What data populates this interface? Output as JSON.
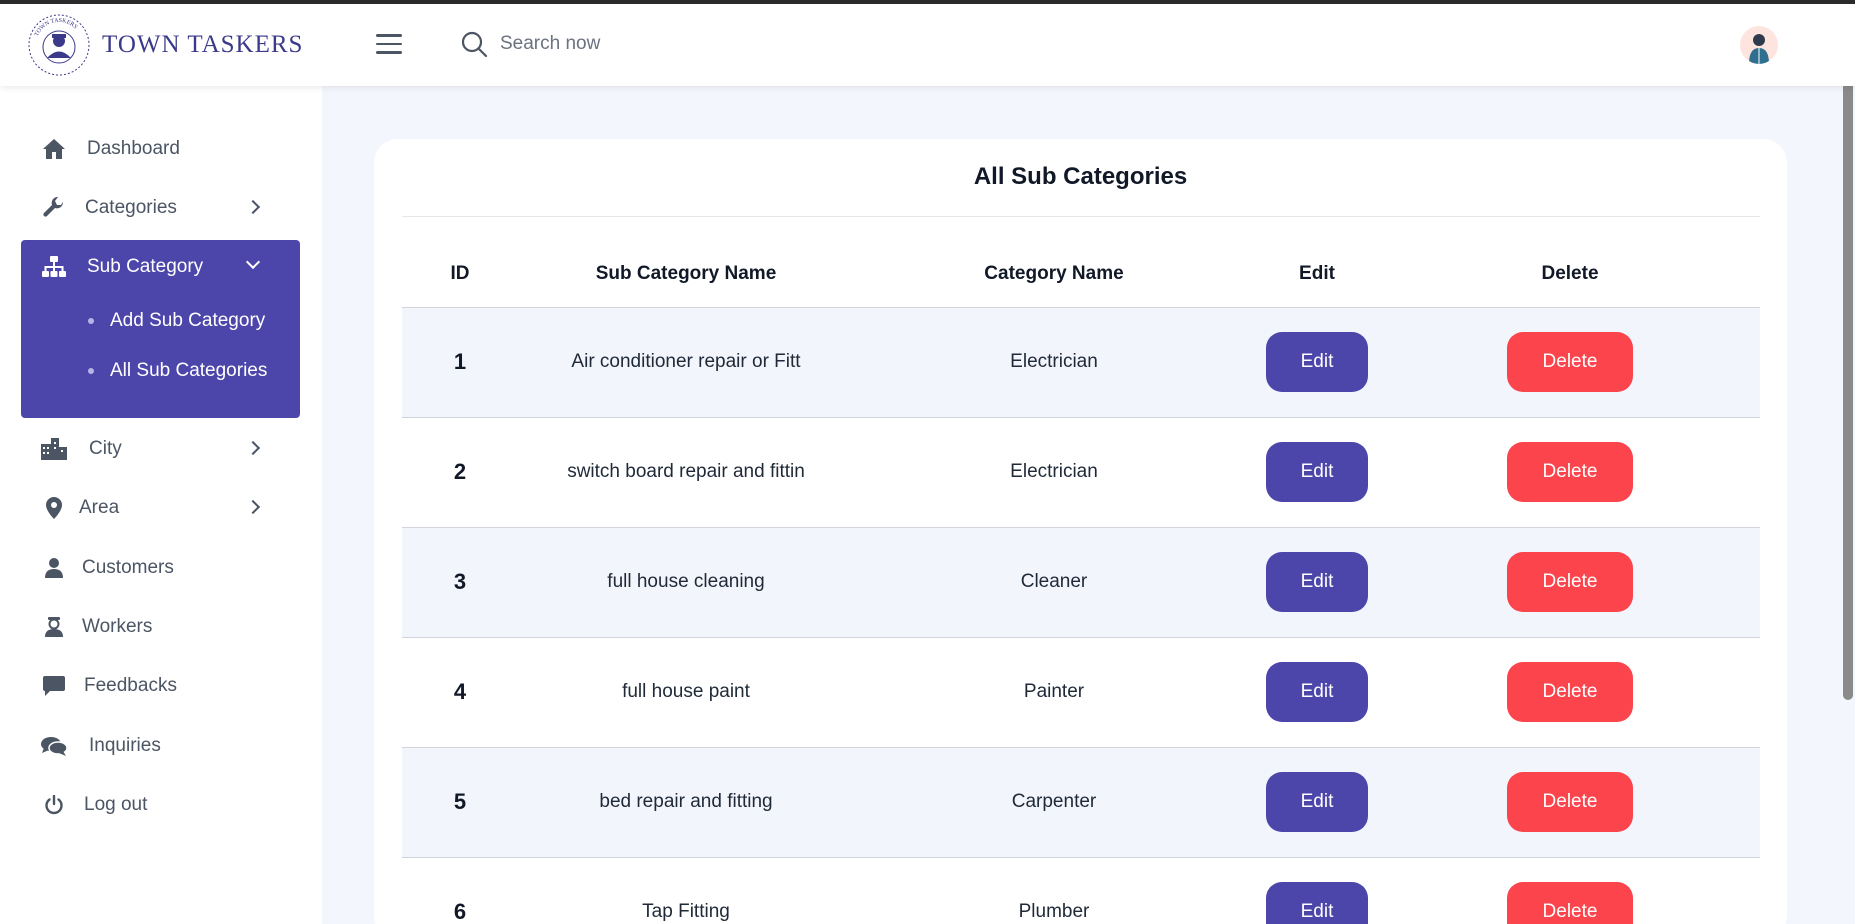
{
  "app": {
    "logo_text": "TOWN TASKERS",
    "logo_ring_text": "TOWN TASKERS"
  },
  "header": {
    "search_placeholder": "Search now"
  },
  "sidebar": {
    "items": [
      {
        "label": "Dashboard",
        "icon": "home-icon"
      },
      {
        "label": "Categories",
        "icon": "wrench-icon"
      },
      {
        "label": "Sub Category",
        "icon": "sitemap-icon",
        "expanded": true
      },
      {
        "label": "City",
        "icon": "city-icon"
      },
      {
        "label": "Area",
        "icon": "map-pin-icon"
      },
      {
        "label": "Customers",
        "icon": "user-icon"
      },
      {
        "label": "Workers",
        "icon": "worker-icon"
      },
      {
        "label": "Feedbacks",
        "icon": "comment-icon"
      },
      {
        "label": "Inquiries",
        "icon": "comments-icon"
      },
      {
        "label": "Log out",
        "icon": "power-icon"
      }
    ],
    "sub_items": [
      "Add Sub Category",
      "All Sub Categories"
    ]
  },
  "main": {
    "title": "All Sub Categories",
    "columns": [
      "ID",
      "Sub Category Name",
      "Category Name",
      "Edit",
      "Delete"
    ],
    "rows": [
      {
        "id": "1",
        "name": "Air conditioner repair or Fitt",
        "category": "Electrician"
      },
      {
        "id": "2",
        "name": "switch board repair and fittin",
        "category": "Electrician"
      },
      {
        "id": "3",
        "name": "full house cleaning",
        "category": "Cleaner"
      },
      {
        "id": "4",
        "name": "full house paint",
        "category": "Painter"
      },
      {
        "id": "5",
        "name": "bed repair and fitting",
        "category": "Carpenter"
      },
      {
        "id": "6",
        "name": "Tap Fitting",
        "category": "Plumber"
      }
    ],
    "edit_label": "Edit",
    "delete_label": "Delete"
  },
  "colors": {
    "accent": "#4c46ab",
    "danger": "#fb444c",
    "background": "#f4f6fd"
  }
}
